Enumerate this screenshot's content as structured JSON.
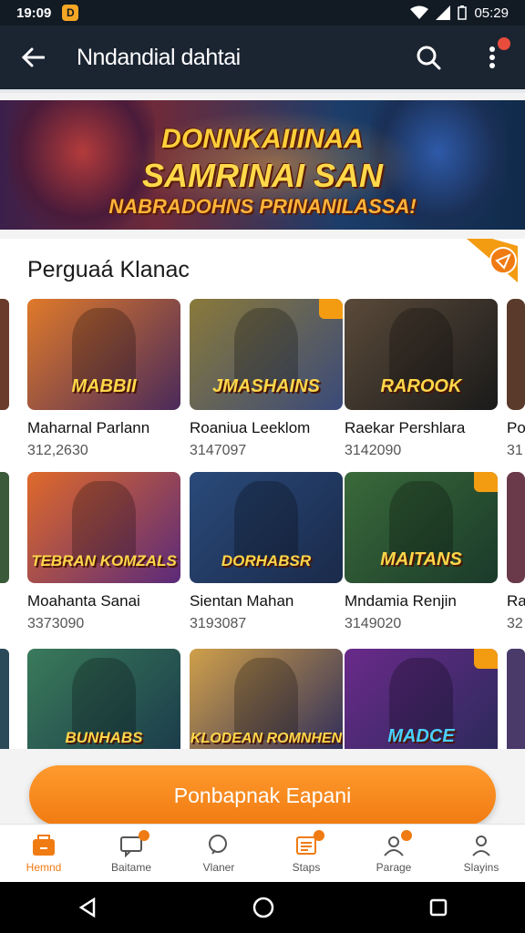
{
  "status_bar": {
    "time": "19:09",
    "notif_icon": "D",
    "clock_right": "05:29"
  },
  "app_bar": {
    "title": "Nndandial dahtai"
  },
  "banner": {
    "line1": "DONNKAIIINAA",
    "line2": "SAMRINAI SAN",
    "line3": "NABRADOHNS PRINANILASSA!"
  },
  "section": {
    "title": "Perguaá Klanac"
  },
  "rows": [
    [
      {
        "name": "Maharnal Parlann",
        "count": "312,2630",
        "art": "MABBII",
        "colors": [
          "#e07a2a",
          "#4a2a5a"
        ]
      },
      {
        "name": "Roaniua Leeklom",
        "count": "3147097",
        "art": "JMASHAINS",
        "colors": [
          "#8a7a3a",
          "#3a4a7a"
        ]
      },
      {
        "name": "Raekar Pershlara",
        "count": "3142090",
        "art": "RAROOK",
        "colors": [
          "#5a4a3a",
          "#1a1a1a"
        ]
      }
    ],
    [
      {
        "name": "Moahanta Sanai",
        "count": "3373090",
        "art": "TEBRAN KOMZALS",
        "colors": [
          "#e06a2a",
          "#5a2a7a"
        ]
      },
      {
        "name": "Sientan Mahan",
        "count": "3193087",
        "art": "DORHABSR",
        "colors": [
          "#2a4a7a",
          "#1a2a4a"
        ]
      },
      {
        "name": "Mndamia Renjin",
        "count": "3149020",
        "art": "MAITANS",
        "colors": [
          "#3a6a3a",
          "#1a3a2a"
        ]
      }
    ],
    [
      {
        "name": "",
        "count": "",
        "art": "BUNHABS",
        "colors": [
          "#3a7a5a",
          "#1a3a4a"
        ]
      },
      {
        "name": "",
        "count": "",
        "art": "KLODEAN ROMNHEN",
        "colors": [
          "#d0a04a",
          "#2a2a5a"
        ]
      },
      {
        "name": "",
        "count": "",
        "art": "MADCE",
        "colors": [
          "#6a2a8a",
          "#2a2a5a"
        ]
      }
    ]
  ],
  "edge_right": [
    "Po",
    "Ra"
  ],
  "edge_right_counts": [
    "31",
    "32"
  ],
  "cta": {
    "label": "Ponbapnak Eapani"
  },
  "bottom_nav": [
    {
      "label": "Hemnd",
      "icon": "home-icon"
    },
    {
      "label": "Baitame",
      "icon": "chat-icon"
    },
    {
      "label": "Vlaner",
      "icon": "search-icon"
    },
    {
      "label": "Staps",
      "icon": "list-icon"
    },
    {
      "label": "Parage",
      "icon": "group-icon"
    },
    {
      "label": "Slayins",
      "icon": "profile-icon"
    }
  ],
  "colors": {
    "accent": "#f07b12",
    "appbar": "#1b2431"
  }
}
